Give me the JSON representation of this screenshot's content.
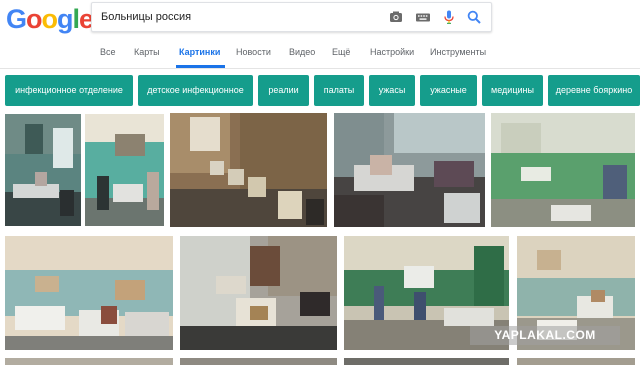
{
  "logo": {
    "letters": [
      "G",
      "o",
      "o",
      "g",
      "l",
      "e"
    ],
    "colors": [
      "#4285f4",
      "#ea4335",
      "#fbbc05",
      "#4285f4",
      "#34a853",
      "#ea4335"
    ]
  },
  "search": {
    "query": "Больницы россия",
    "icons": [
      "camera-icon",
      "keyboard-icon",
      "microphone-icon",
      "search-icon"
    ]
  },
  "tabs": [
    {
      "label": "Все",
      "active": false
    },
    {
      "label": "Карты",
      "active": false
    },
    {
      "label": "Картинки",
      "active": true
    },
    {
      "label": "Новости",
      "active": false
    },
    {
      "label": "Видео",
      "active": false
    },
    {
      "label": "Ещё",
      "active": false
    },
    {
      "label": "Настройки",
      "active": false
    },
    {
      "label": "Инструменты",
      "active": false
    }
  ],
  "chips": [
    "инфекционное отделение",
    "детское инфекционное",
    "реалии",
    "палаты",
    "ужасы",
    "ужасные",
    "медицины",
    "деревне бояркино"
  ],
  "colors": {
    "accent": "#1a73e8",
    "chip": "#159d8c"
  },
  "watermark": "YAPLAKAL.COM"
}
